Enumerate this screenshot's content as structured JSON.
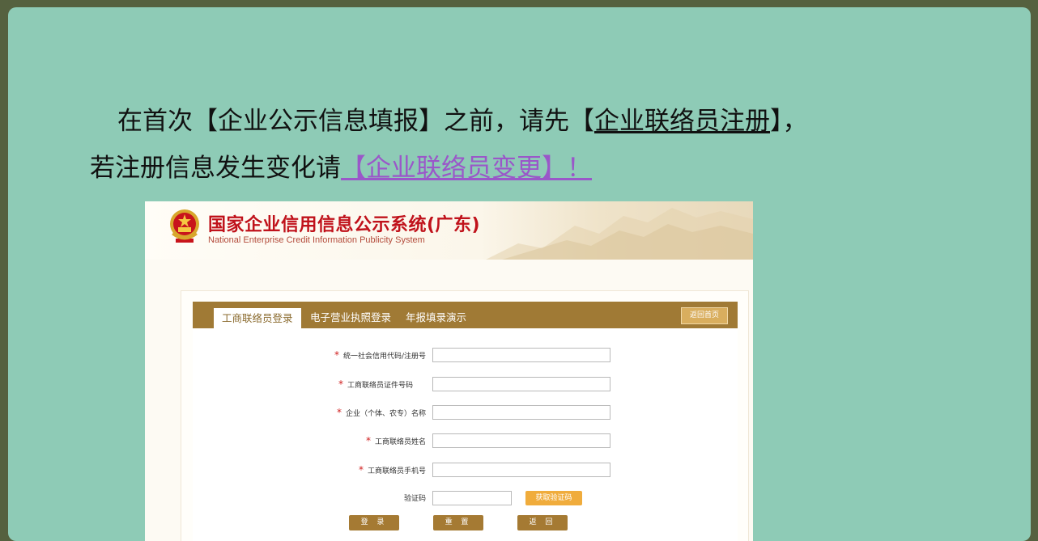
{
  "notice": {
    "line1_prefix": "在首次【企业公示信息填报】之前，请先【",
    "register_link": "企业联络员注册",
    "line1_suffix": "】，",
    "line2_prefix": "若注册信息发生变化请",
    "change_link": "【企业联络员变更】！"
  },
  "system": {
    "title": "国家企业信用信息公示系统(广东)",
    "subtitle": "National Enterprise Credit Information Publicity System"
  },
  "tabs": [
    {
      "label": "工商联络员登录"
    },
    {
      "label": "电子营业执照登录"
    },
    {
      "label": "年报填录演示"
    }
  ],
  "home_button": "返回首页",
  "form": {
    "fields": [
      {
        "label": "统一社会信用代码/注册号",
        "value": ""
      },
      {
        "label": "工商联络员证件号码",
        "value": ""
      },
      {
        "label": "企业（个体、农专）名称",
        "value": ""
      },
      {
        "label": "工商联络员姓名",
        "value": ""
      },
      {
        "label": "工商联络员手机号",
        "value": ""
      }
    ],
    "captcha_label": "验证码",
    "captcha_value": "",
    "get_code_button": "获取验证码",
    "login_button": "登 录",
    "reset_button": "重 置",
    "back_button": "返 回"
  },
  "colors": {
    "outer_bg": "#55613f",
    "panel_bg": "#8ecbb6",
    "title_red": "#c0121b",
    "tabbar_brown": "#a07a35",
    "link_purple": "#9a57c9",
    "required_red": "#d02020",
    "code_button_orange": "#f0ac3c"
  },
  "icons": {
    "emblem": "national-emblem-icon"
  }
}
